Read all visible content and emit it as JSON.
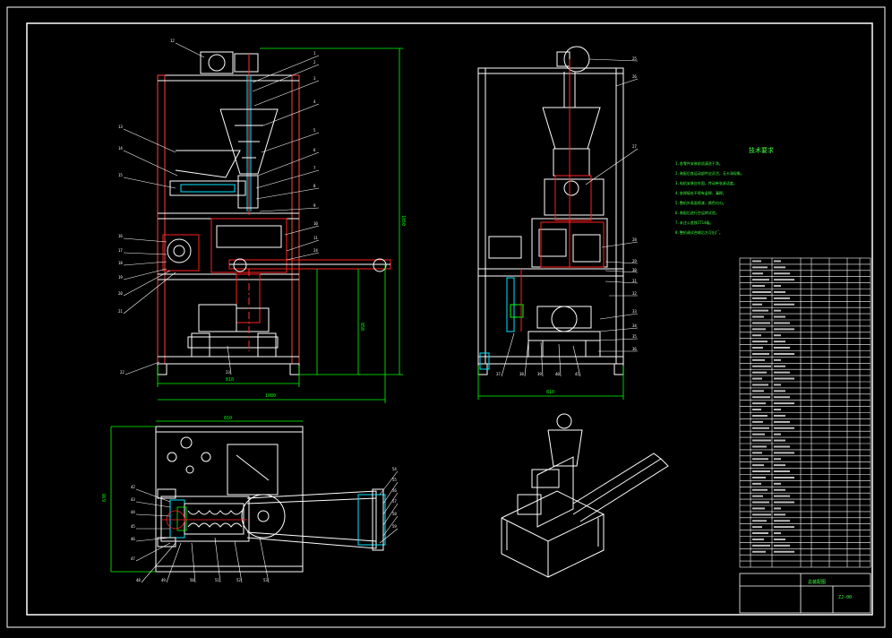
{
  "colors": {
    "background": "#000000",
    "line": "#ffffff",
    "dimension": "#00ff00",
    "hidden": "#ff2020",
    "accent": "#00e5ff",
    "heading": "#40ff40"
  },
  "notes": {
    "heading": "技术要求",
    "items": [
      "1.各零件安装前须清洗干净。",
      "2.装配后各运动部件应灵活，无卡滞现象。",
      "3.电机安装应牢固，传动带张紧适度。",
      "4.各焊接处不得有虚焊、漏焊。",
      "5.整机外表面喷漆，颜色均匀。",
      "6.装配后进行空运转试验。",
      "7.未注公差按IT14级。",
      "8.整机调试合格后方可出厂。"
    ]
  },
  "title_block": {
    "drawing_name": "总装配图",
    "drawing_code": "ZJ-00"
  },
  "front_view": {
    "dims": {
      "width": "810",
      "overall": "1080",
      "height": "1850",
      "h2": "850"
    },
    "balloons": [
      "12",
      "1",
      "2",
      "3",
      "4",
      "5",
      "6",
      "7",
      "8",
      "9",
      "10",
      "11",
      "13",
      "14",
      "15",
      "16",
      "17",
      "18",
      "19",
      "20",
      "21",
      "22",
      "23",
      "24"
    ]
  },
  "side_view": {
    "dims": {
      "width": "810"
    },
    "balloons": [
      "25",
      "26",
      "27",
      "28",
      "29",
      "30",
      "31",
      "32",
      "33",
      "34",
      "35",
      "36",
      "37",
      "38",
      "39",
      "40",
      "41"
    ]
  },
  "top_view": {
    "dims": {
      "width": "810",
      "depth": "630"
    },
    "balloons": [
      "42",
      "43",
      "44",
      "45",
      "46",
      "47",
      "48",
      "49",
      "50",
      "51",
      "52",
      "53",
      "54",
      "55",
      "56",
      "57",
      "58",
      "59"
    ]
  }
}
